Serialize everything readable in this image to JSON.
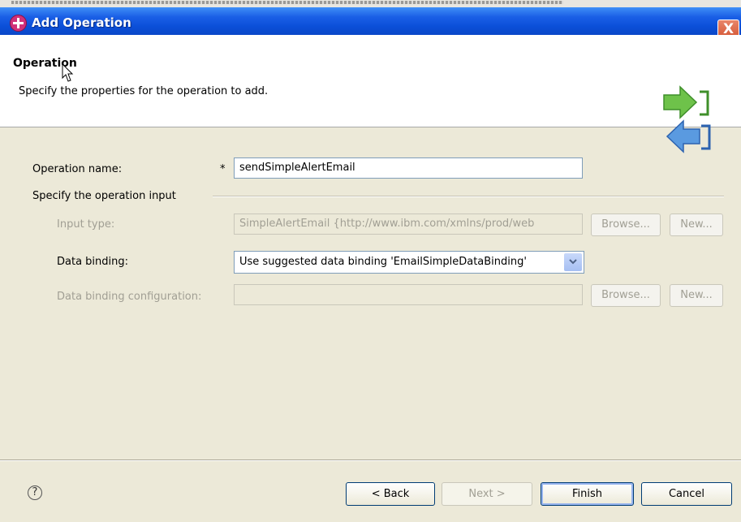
{
  "window": {
    "title": "Add Operation",
    "close_label": "X"
  },
  "header": {
    "title": "Operation",
    "description": "Specify the properties for the operation to add."
  },
  "form": {
    "operation_name_label": "Operation name:",
    "required_marker": "*",
    "operation_name_value": "sendSimpleAlertEmail",
    "section_label": "Specify the operation input",
    "input_type_label": "Input type:",
    "input_type_value": "SimpleAlertEmail  {http://www.ibm.com/xmlns/prod/web",
    "browse_label": "Browse...",
    "new_label": "New...",
    "data_binding_label": "Data binding:",
    "data_binding_value": "Use suggested data binding 'EmailSimpleDataBinding'",
    "data_binding_config_label": "Data binding configuration:",
    "data_binding_config_value": ""
  },
  "footer": {
    "help_label": "?",
    "back_label": "< Back",
    "next_label": "Next >",
    "finish_label": "Finish",
    "cancel_label": "Cancel"
  },
  "icons": {
    "app": "add-operation-icon",
    "wizard": "import-export-arrows-icon",
    "help": "help-icon",
    "dropdown": "chevron-down-icon",
    "cursor": "mouse-cursor-icon"
  },
  "colors": {
    "titlebar": "#0b4fd8",
    "dialog_bg": "#ece9d8",
    "disabled_text": "#a19f94"
  }
}
